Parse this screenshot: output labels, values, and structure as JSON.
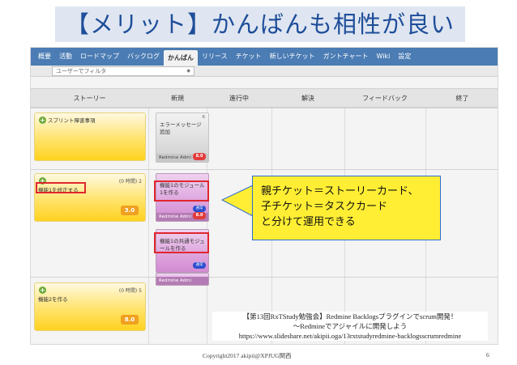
{
  "slide": {
    "title": "【メリット】かんばんも相性が良い",
    "copyright": "Copyright2017 akipii@XPJUG関西",
    "page_number": "6"
  },
  "menu": {
    "items": [
      "概要",
      "活動",
      "ロードマップ",
      "バックログ",
      "かんばん",
      "リリース",
      "チケット",
      "新しいチケット",
      "ガントチャート",
      "Wiki",
      "設定"
    ],
    "active_index": 4
  },
  "filter": {
    "value": "ユーザーでフィルタ",
    "caret": "◆"
  },
  "columns": [
    "ストーリー",
    "新規",
    "進行中",
    "解決",
    "フィードバック",
    "終了"
  ],
  "stories": [
    {
      "title": "スプリント障害事項",
      "hours": "",
      "subtitle": "",
      "points": ""
    },
    {
      "title": "",
      "hours": "(0 時間) 2",
      "subtitle": "機能1を修正する",
      "points": "3.0"
    },
    {
      "title": "",
      "hours": "(0 時間) 5",
      "subtitle": "機能2を作る",
      "points": "8.0"
    }
  ],
  "tasks": [
    {
      "num": "6",
      "text": "エラーメッセージ追加",
      "assignee": "Redmine Admi",
      "badge": "8.0",
      "status": "",
      "color": "grey"
    },
    {
      "num": "",
      "text": "機能1のモジュール1を作る",
      "assignee": "Redmine Admi",
      "badge": "8.0",
      "status": "通常",
      "color": "purple"
    },
    {
      "num": "",
      "text": "機能1の共通モジュールを作る",
      "assignee": "",
      "badge": "",
      "status": "通常",
      "color": "purple"
    },
    {
      "num": "",
      "text": "",
      "assignee": "Redmine Admi",
      "badge": "",
      "status": "",
      "color": "purple"
    }
  ],
  "callout": {
    "line1": "親チケット＝ストーリーカード、",
    "line2": "子チケット＝タスクカード",
    "line3": "と分けて運用できる"
  },
  "reference": {
    "line1": "【第13回RxTStudy勉強会】Redmine Backlogsプラグインでscrum開発！",
    "line2": "～Redmineでアジャイルに開発しよう",
    "line3": "https://www.slideshare.net/akipii.oga/13rxtstudyredmine-backlogsscrumredmine"
  },
  "colors": {
    "menubar": "#4b7cb4",
    "story_card": "#ffe36b",
    "task_card": "#dda4dd",
    "highlight_border": "#e0262e",
    "callout_bg": "#ffee33",
    "callout_border": "#2e6ccd",
    "title_text": "#1f4e9a"
  }
}
